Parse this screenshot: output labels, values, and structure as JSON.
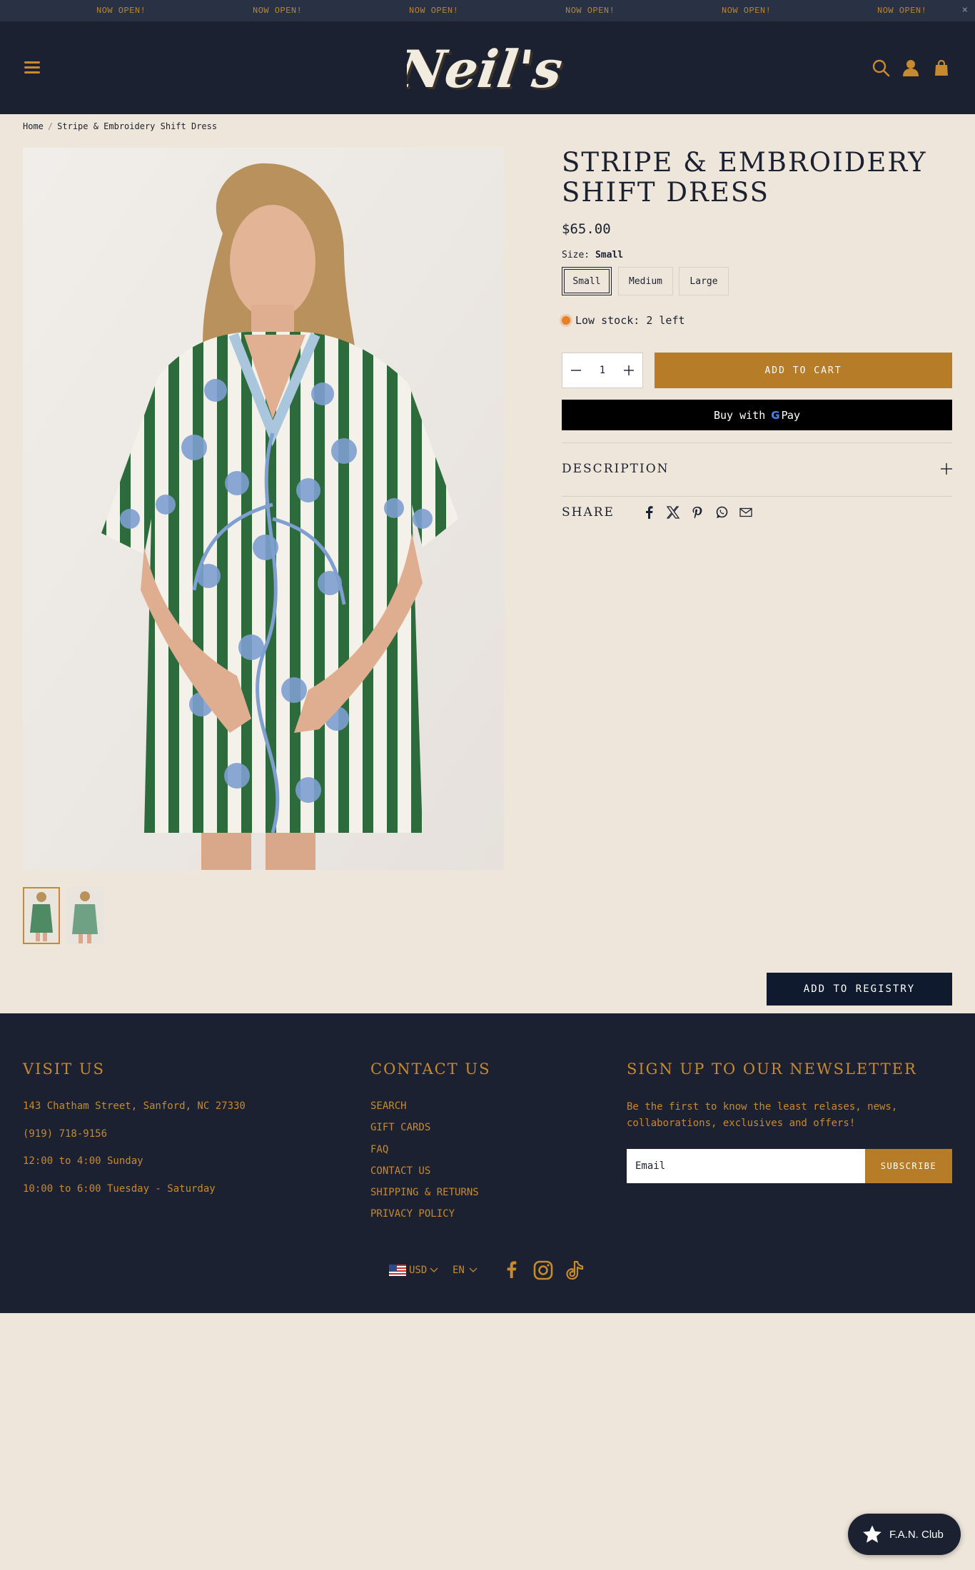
{
  "announcement": {
    "messages": [
      "NOW OPEN!",
      "NOW OPEN!",
      "NOW OPEN!",
      "NOW OPEN!",
      "NOW OPEN!",
      "NOW OPEN!"
    ],
    "close_label": "×"
  },
  "header": {
    "logo_text": "Neil's",
    "icons": [
      "menu-icon",
      "search-icon",
      "account-icon",
      "cart-icon"
    ]
  },
  "breadcrumb": {
    "home": "Home",
    "separator": "/",
    "current": "Stripe & Embroidery Shift Dress"
  },
  "product": {
    "title": "STRIPE & EMBROIDERY SHIFT DRESS",
    "price": "$65.00",
    "size_label": "Size:",
    "selected_size": "Small",
    "sizes": [
      "Small",
      "Medium",
      "Large"
    ],
    "stock_text": "Low stock: 2 left",
    "quantity": "1",
    "add_to_cart": "ADD TO CART",
    "buy_with": "Buy with",
    "gpay_g": "G",
    "gpay_pay": "Pay",
    "description_label": "DESCRIPTION",
    "share_label": "SHARE",
    "share_icons": [
      "facebook-icon",
      "x-icon",
      "pinterest-icon",
      "whatsapp-icon",
      "email-icon"
    ],
    "add_to_registry": "ADD TO REGISTRY"
  },
  "footer": {
    "visit": {
      "heading": "VISIT US",
      "lines": [
        "143 Chatham Street, Sanford, NC 27330",
        "(919) 718-9156",
        "12:00 to 4:00 Sunday",
        "10:00 to 6:00 Tuesday - Saturday"
      ]
    },
    "contact": {
      "heading": "CONTACT US",
      "links": [
        "SEARCH",
        "GIFT CARDS",
        "FAQ",
        "CONTACT US",
        "SHIPPING & RETURNS",
        "PRIVACY POLICY"
      ]
    },
    "newsletter": {
      "heading": "SIGN UP TO OUR NEWSLETTER",
      "text": "Be the first to know the least relases, news, collaborations, exclusives and offers!",
      "email_placeholder": "Email",
      "subscribe": "SUBSCRIBE"
    },
    "currency": "USD",
    "language": "EN",
    "social_icons": [
      "facebook-icon",
      "instagram-icon",
      "tiktok-icon"
    ]
  },
  "fan_club": {
    "label": "F.A.N. Club"
  },
  "colors": {
    "navy": "#1B2130",
    "gold": "#C78A2E",
    "cream": "#EEE6DA",
    "stock_orange": "#E57F2A"
  }
}
